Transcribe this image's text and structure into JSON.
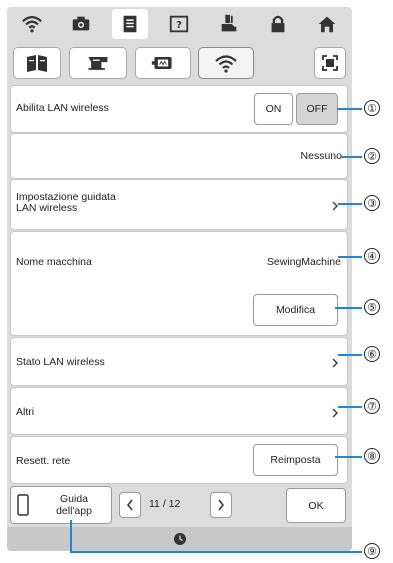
{
  "wlan_enable": {
    "label": "Abilita LAN wireless",
    "on": "ON",
    "off": "OFF",
    "selected": "OFF"
  },
  "network_name": "Nessuno",
  "setup_wizard": {
    "label_line1": "Impostazione guidata",
    "label_line2": "LAN wireless"
  },
  "machine_name": {
    "label": "Nome macchina",
    "value": "SewingMachine",
    "edit_button": "Modifica"
  },
  "wlan_status": {
    "label": "Stato LAN wireless"
  },
  "others": {
    "label": "Altri"
  },
  "network_reset": {
    "label": "Resett. rete",
    "button": "Reimposta"
  },
  "footer": {
    "app_guide_line1": "Guida",
    "app_guide_line2": "dell'app",
    "page": "11 / 12",
    "ok": "OK"
  },
  "callouts": [
    "①",
    "②",
    "③",
    "④",
    "⑤",
    "⑥",
    "⑦",
    "⑧",
    "⑨"
  ],
  "colors": {
    "accent_line": "#1e88d6",
    "screen_bg": "#dcdcdc"
  },
  "icons": {
    "top_tabs": [
      "wifi-icon",
      "camera-icon",
      "document-icon",
      "help-icon",
      "presser-foot-icon",
      "lock-icon",
      "home-icon"
    ],
    "sub_tabs": [
      "book-icon",
      "sewing-machine-icon",
      "embroidery-card-icon",
      "wifi-icon"
    ]
  }
}
